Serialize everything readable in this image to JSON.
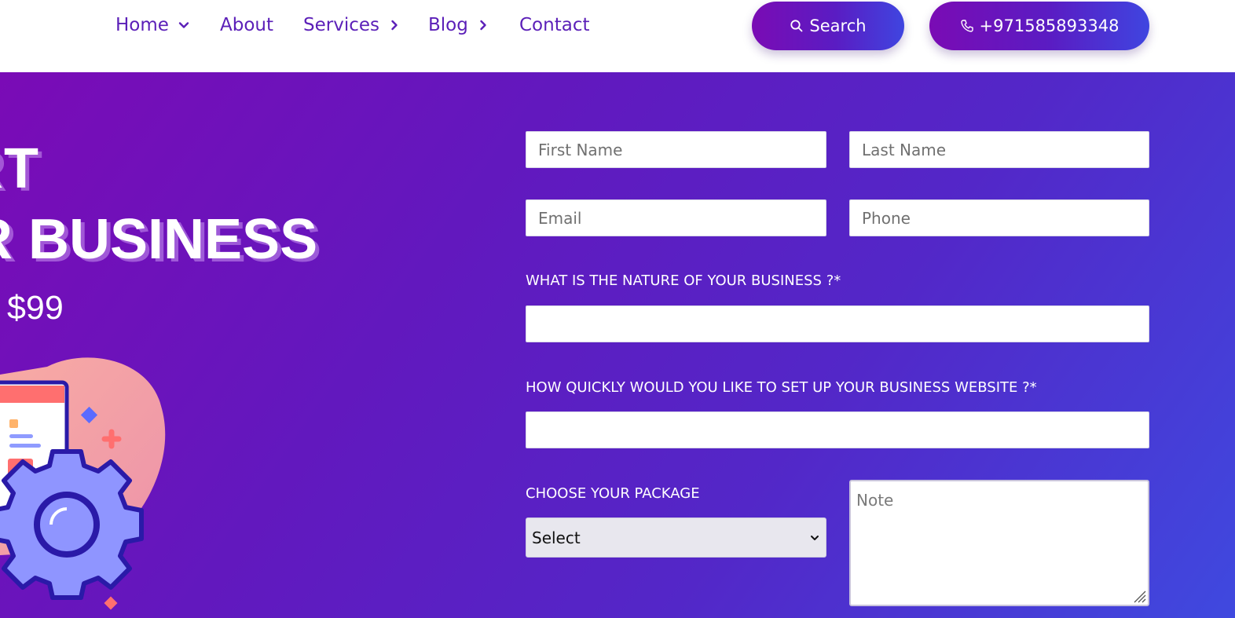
{
  "nav": {
    "items": [
      {
        "label": "Home",
        "has_dropdown": true
      },
      {
        "label": "About",
        "has_dropdown": false
      },
      {
        "label": "Services",
        "has_dropdown": true
      },
      {
        "label": "Blog",
        "has_dropdown": true
      },
      {
        "label": "Contact",
        "has_dropdown": false
      }
    ],
    "search_label": "Search",
    "phone_label": "+971585893348",
    "text_color": "#5b1fb8"
  },
  "hero": {
    "headline_line1": "RT",
    "headline_line2": "R BUSINESS",
    "price": "$99",
    "gradient_start": "#7a0bb6",
    "gradient_end": "#3f49df"
  },
  "form": {
    "first_name_placeholder": "First Name",
    "last_name_placeholder": "Last Name",
    "email_placeholder": "Email",
    "phone_placeholder": "Phone",
    "nature_label": "WHAT IS THE NATURE OF YOUR BUSINESS ?*",
    "nature_value": "",
    "speed_label": "HOW QUICKLY WOULD YOU LIKE TO SET UP YOUR BUSINESS WEBSITE ?*",
    "speed_value": "",
    "package_label": "CHOOSE YOUR PACKAGE",
    "package_selected": "Select",
    "note_placeholder": "Note"
  },
  "icons": {
    "search": "search-icon",
    "phone": "phone-icon",
    "chevron_down": "chevron-down-icon",
    "chevron_right": "chevron-right-icon"
  }
}
